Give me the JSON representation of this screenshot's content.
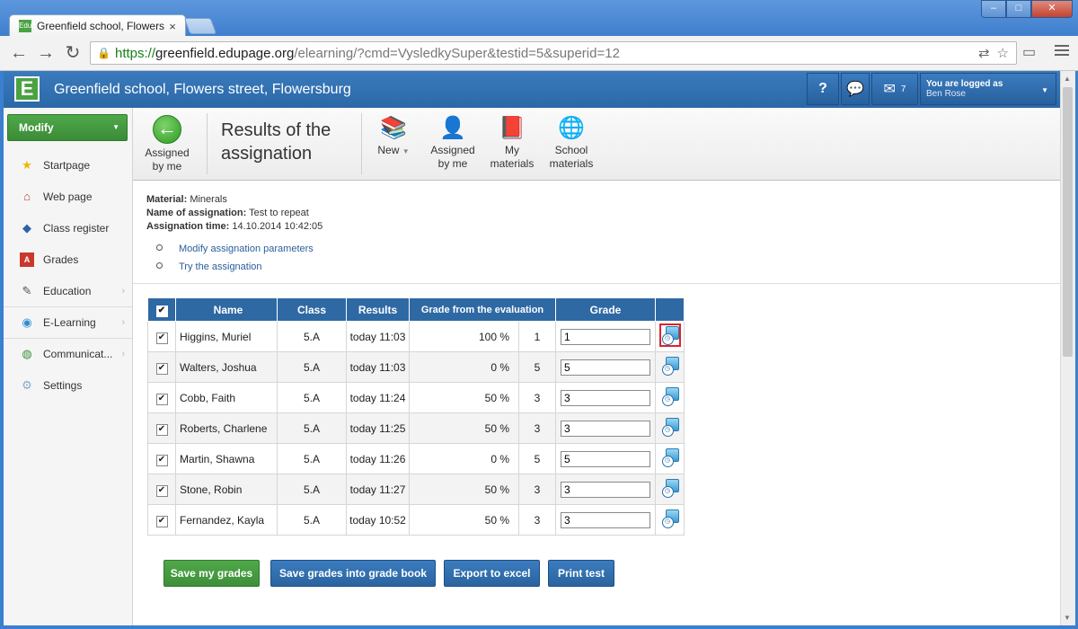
{
  "browser": {
    "tab_title": "Greenfield school, Flowers",
    "tab_favicon": "Edu",
    "tab_close": "×",
    "url_scheme": "https://",
    "url_host": "greenfield.edupage.org",
    "url_path": "/elearning/?cmd=VysledkySuper&testid=5&superid=12"
  },
  "header": {
    "logo_letter": "E",
    "school_name": "Greenfield school, Flowers street, Flowersburg",
    "help_label": "?",
    "mail_count": "7",
    "logged_label": "You are logged as",
    "user_name": "Ben Rose"
  },
  "sidebar": {
    "modify_label": "Modify",
    "items": [
      {
        "label": "Startpage",
        "icon": "star-icon"
      },
      {
        "label": "Web page",
        "icon": "house-icon"
      },
      {
        "label": "Class register",
        "icon": "book-icon"
      },
      {
        "label": "Grades",
        "icon": "grades-icon"
      },
      {
        "label": "Education",
        "icon": "education-icon"
      },
      {
        "label": "E-Learning",
        "icon": "globe-icon"
      },
      {
        "label": "Communicat...",
        "icon": "globe-people-icon"
      },
      {
        "label": "Settings",
        "icon": "gear-icon"
      }
    ]
  },
  "ribbon": {
    "back_line1": "Assigned",
    "back_line2": "by me",
    "title_line1": "Results of the",
    "title_line2": "assignation",
    "buttons": [
      {
        "line1": "New",
        "line2": ""
      },
      {
        "line1": "Assigned",
        "line2": "by me"
      },
      {
        "line1": "My",
        "line2": "materials"
      },
      {
        "line1": "School",
        "line2": "materials"
      }
    ]
  },
  "info": {
    "material_label": "Material:",
    "material_value": "Minerals",
    "name_label": "Name of assignation:",
    "name_value": "Test to repeat",
    "time_label": "Assignation time:",
    "time_value": "14.10.2014 10:42:05",
    "link_modify": "Modify assignation parameters",
    "link_try": "Try the assignation"
  },
  "table": {
    "headers": {
      "name": "Name",
      "class": "Class",
      "results": "Results",
      "eval": "Grade from the evaluation",
      "grade": "Grade"
    },
    "rows": [
      {
        "name": "Higgins, Muriel",
        "class": "5.A",
        "result": "today 11:03",
        "percent": "100 %",
        "eval_grade": "1",
        "grade": "1"
      },
      {
        "name": "Walters, Joshua",
        "class": "5.A",
        "result": "today 11:03",
        "percent": "0 %",
        "eval_grade": "5",
        "grade": "5"
      },
      {
        "name": "Cobb, Faith",
        "class": "5.A",
        "result": "today 11:24",
        "percent": "50 %",
        "eval_grade": "3",
        "grade": "3"
      },
      {
        "name": "Roberts, Charlene",
        "class": "5.A",
        "result": "today 11:25",
        "percent": "50 %",
        "eval_grade": "3",
        "grade": "3"
      },
      {
        "name": "Martin, Shawna",
        "class": "5.A",
        "result": "today 11:26",
        "percent": "0 %",
        "eval_grade": "5",
        "grade": "5"
      },
      {
        "name": "Stone, Robin",
        "class": "5.A",
        "result": "today 11:27",
        "percent": "50 %",
        "eval_grade": "3",
        "grade": "3"
      },
      {
        "name": "Fernandez, Kayla",
        "class": "5.A",
        "result": "today 10:52",
        "percent": "50 %",
        "eval_grade": "3",
        "grade": "3"
      }
    ]
  },
  "actions": {
    "save_my": "Save my grades",
    "save_book": "Save grades into grade book",
    "export": "Export to excel",
    "print": "Print test"
  }
}
